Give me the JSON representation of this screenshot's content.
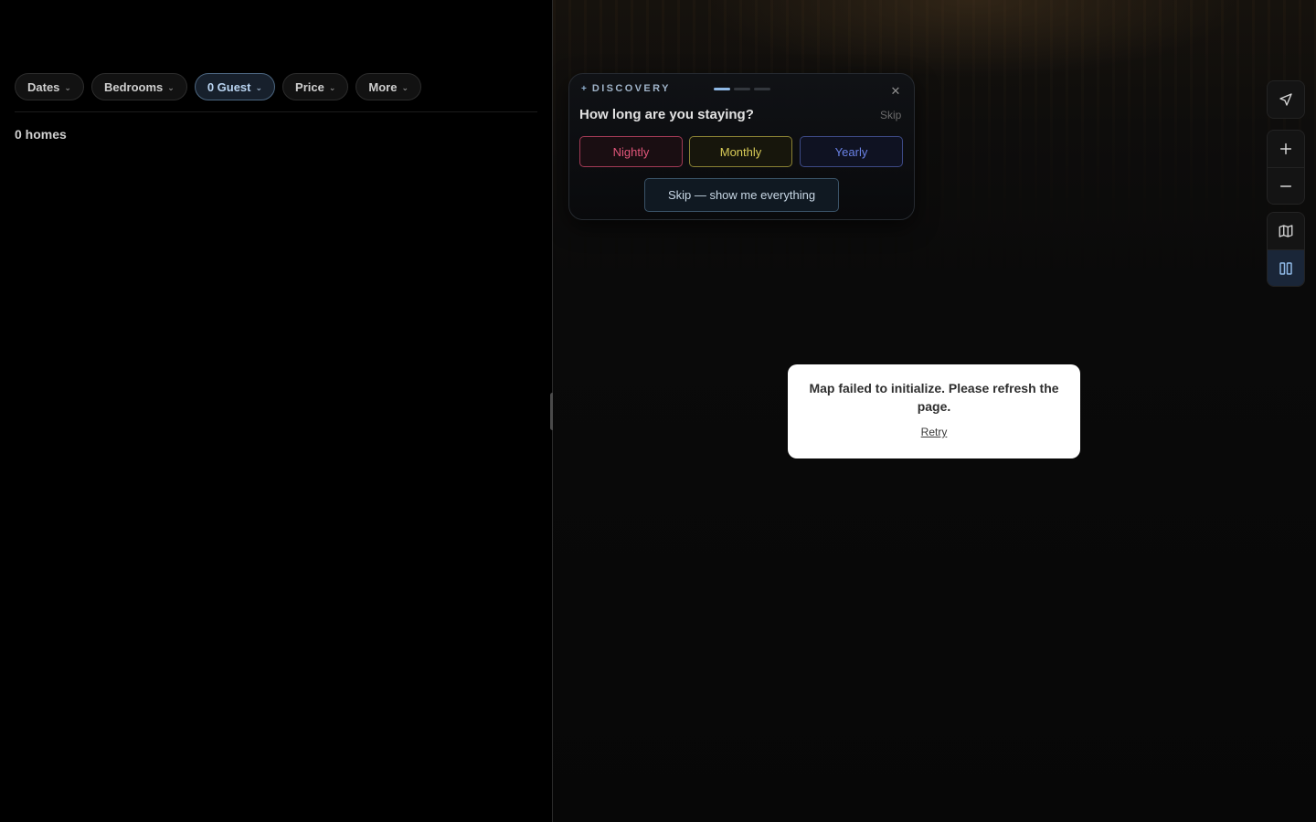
{
  "filters": {
    "chips": [
      {
        "label": "Dates"
      },
      {
        "label": "Bedrooms"
      },
      {
        "label": "0 Guest"
      },
      {
        "label": "Price"
      },
      {
        "label": "More"
      }
    ],
    "active_chip": "0 Guest"
  },
  "results": {
    "count_label": "0 homes"
  },
  "discovery": {
    "label": "DISCOVERY",
    "step": 1,
    "total_steps": 3,
    "question": "How long are you staying?",
    "skip_label": "Skip",
    "options": [
      {
        "label": "Nightly",
        "color": "#e0567a"
      },
      {
        "label": "Monthly",
        "color": "#d8cb57"
      },
      {
        "label": "Yearly",
        "color": "#6a82e6"
      }
    ],
    "skip_all_label": "Skip — show me everything",
    "close_icon": "close-icon"
  },
  "map_controls": {
    "icons": [
      "navigation-arrow-icon",
      "plus-icon",
      "minus-icon",
      "map-icon",
      "split-view-icon"
    ],
    "active": "split-view-icon"
  },
  "error": {
    "message": "Map failed to initialize. Please refresh the page.",
    "retry_label": "Retry"
  }
}
